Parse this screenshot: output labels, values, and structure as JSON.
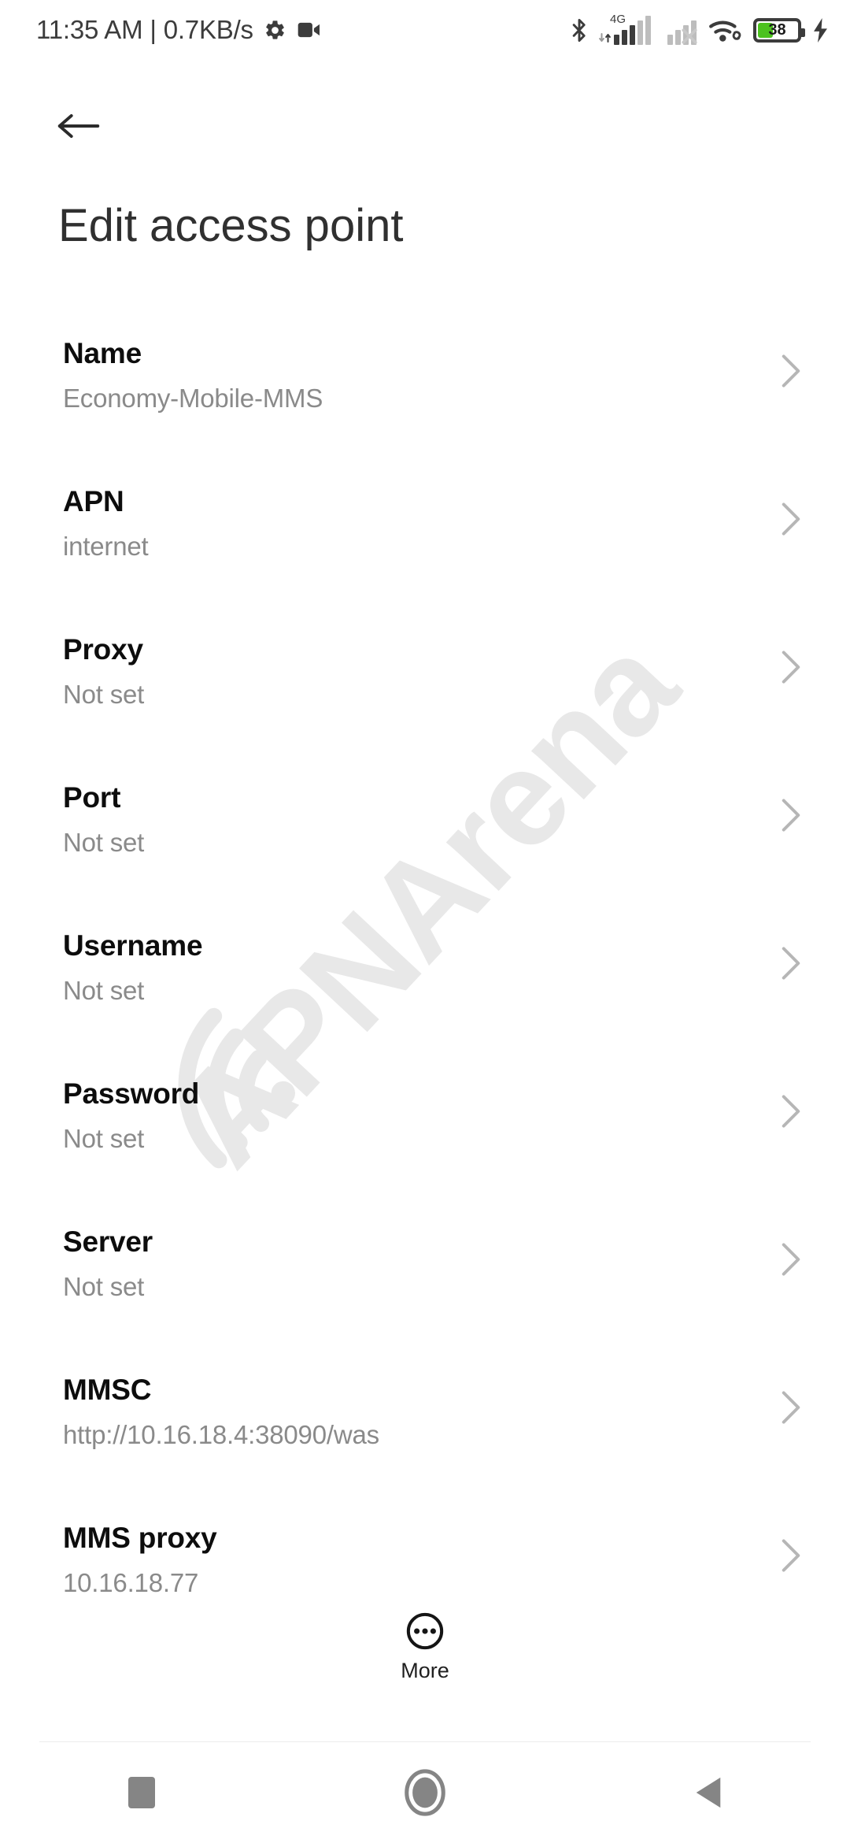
{
  "status_bar": {
    "clock": "11:35 AM | 0.7KB/s",
    "gear_icon": "gear-icon",
    "video_icon": "video-camera-icon",
    "bluetooth_icon": "bluetooth-icon",
    "network_label": "4G",
    "sim1_icon": "signal-bars-icon",
    "sim2_icon": "signal-no-service-icon",
    "wifi_icon": "wifi-icon",
    "battery_level": "38",
    "battery_percent": 38,
    "charging_icon": "charging-bolt-icon",
    "battery_color": "#4cc21f"
  },
  "header": {
    "back_icon": "arrow-left-icon",
    "title": "Edit access point"
  },
  "watermark": {
    "text": "APNArena",
    "color": "#e8e8e8",
    "icon": "wifi-arc-icon"
  },
  "settings": {
    "chevron_icon": "chevron-right-icon",
    "rows": [
      {
        "label": "Name",
        "value": "Economy-Mobile-MMS"
      },
      {
        "label": "APN",
        "value": "internet"
      },
      {
        "label": "Proxy",
        "value": "Not set"
      },
      {
        "label": "Port",
        "value": "Not set"
      },
      {
        "label": "Username",
        "value": "Not set"
      },
      {
        "label": "Password",
        "value": "Not set"
      },
      {
        "label": "Server",
        "value": "Not set"
      },
      {
        "label": "MMSC",
        "value": "http://10.16.18.4:38090/was"
      },
      {
        "label": "MMS proxy",
        "value": "10.16.18.77"
      }
    ]
  },
  "more_button": {
    "label": "More",
    "icon": "more-horizontal-circle-icon"
  },
  "nav_bar": {
    "recents_icon": "square-recents-icon",
    "home_icon": "circle-home-icon",
    "back_icon": "triangle-back-icon",
    "color": "#858585"
  }
}
